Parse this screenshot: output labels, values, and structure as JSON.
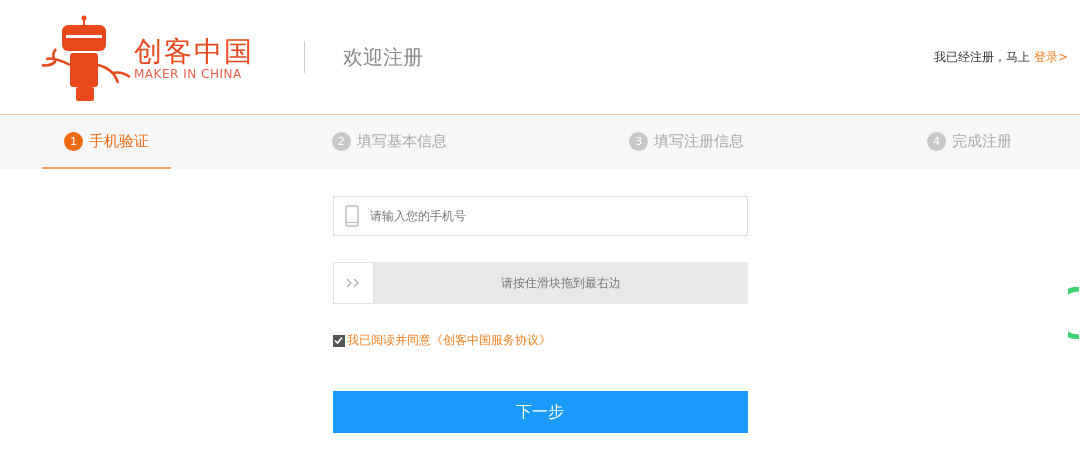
{
  "header": {
    "logo": {
      "name": "创客中国",
      "tagline": "MAKER IN CHINA"
    },
    "page_title": "欢迎注册",
    "login_prompt": "我已经注册，马上",
    "login_link": "登录>"
  },
  "steps": [
    {
      "number": "1",
      "label": "手机验证",
      "selected": true
    },
    {
      "number": "2",
      "label": "填写基本信息",
      "selected": false
    },
    {
      "number": "3",
      "label": "填写注册信息",
      "selected": false
    },
    {
      "number": "4",
      "label": "完成注册",
      "selected": false
    }
  ],
  "form": {
    "phone": {
      "placeholder": "请输入您的手机号"
    },
    "slider": {
      "label": "请按住滑块拖到最右边",
      "level": 0
    },
    "agreement": {
      "checked": true,
      "label": "我已阅读并同意《创客中国服务协议》"
    },
    "submit": "下一步"
  }
}
